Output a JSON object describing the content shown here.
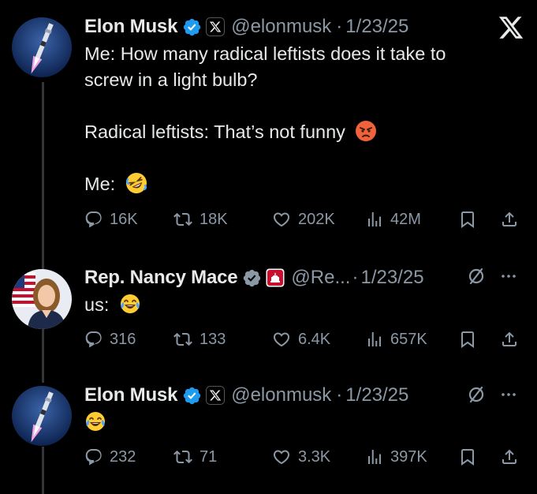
{
  "tweets": [
    {
      "name": "Elon Musk",
      "handle": "@elonmusk",
      "sep": "·",
      "time": "1/23/25",
      "lines": [
        "Me: How many radical leftists does it take to",
        "screw in a light bulb?",
        "",
        "Radical leftists: That’s not funny",
        "",
        "Me:"
      ],
      "emoji": [
        "pouting-face",
        "rofl-face"
      ],
      "replies": "16K",
      "reposts": "18K",
      "likes": "202K",
      "views": "42M"
    },
    {
      "name": "Rep. Nancy Mace",
      "handle": "@Re...",
      "sep": "·",
      "time": "1/23/25",
      "lines": [
        "us:"
      ],
      "emoji": [
        "tears-of-joy-face"
      ],
      "replies": "316",
      "reposts": "133",
      "likes": "6.4K",
      "views": "657K"
    },
    {
      "name": "Elon Musk",
      "handle": "@elonmusk",
      "sep": "·",
      "time": "1/23/25",
      "lines": [],
      "emoji": [
        "tears-of-joy-face"
      ],
      "replies": "232",
      "reposts": "71",
      "likes": "3.3K",
      "views": "397K"
    }
  ],
  "colors": {
    "background": "#000000",
    "text": "#e7e9ea",
    "muted": "#8b98a5",
    "verified": "#1d9bf0",
    "thread_line": "#333639"
  },
  "icons": [
    "x-logo-icon",
    "verified-badge-icon",
    "reply-icon",
    "repost-icon",
    "like-icon",
    "views-icon",
    "bookmark-icon",
    "share-icon",
    "grok-icon",
    "more-icon"
  ]
}
